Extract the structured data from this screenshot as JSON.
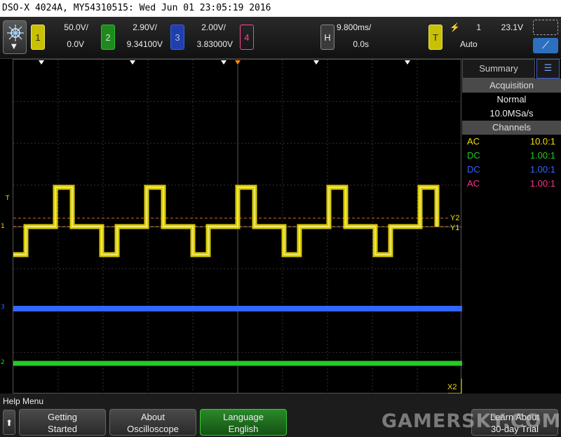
{
  "title_bar": "DSO-X 4024A, MY54310515: Wed Jun 01 23:05:19 2016",
  "channels": [
    {
      "label": "1",
      "scale": "50.0V/",
      "offset": "0.0V",
      "color": "#f0e000"
    },
    {
      "label": "2",
      "scale": "2.90V/",
      "offset": "9.34100V",
      "color": "#22cc22"
    },
    {
      "label": "3",
      "scale": "2.00V/",
      "offset": "3.83000V",
      "color": "#3366ff"
    },
    {
      "label": "4",
      "scale": "",
      "offset": "",
      "color": "#ff3388"
    }
  ],
  "horizontal": {
    "label": "H",
    "timebase": "9.800ms/",
    "delay": "0.0s"
  },
  "trigger": {
    "label": "T",
    "slope_icon": "rising-edge-icon",
    "source": "1",
    "level": "23.1V",
    "mode": "Auto"
  },
  "side_panel": {
    "tab_label": "Summary",
    "acquisition_header": "Acquisition",
    "acq_mode": "Normal",
    "sample_rate": "10.0MSa/s",
    "channels_header": "Channels",
    "channel_rows": [
      {
        "coupling": "AC",
        "probe": "10.0:1",
        "color": "#f0e000"
      },
      {
        "coupling": "DC",
        "probe": "1.00:1",
        "color": "#22cc22"
      },
      {
        "coupling": "DC",
        "probe": "1.00:1",
        "color": "#3366ff"
      },
      {
        "coupling": "AC",
        "probe": "1.00:1",
        "color": "#ff3388"
      }
    ]
  },
  "cursors": {
    "y2": "Y2",
    "y1": "Y1",
    "x2": "X2"
  },
  "graticule_markers": {
    "trigger": "T",
    "ch1": "1",
    "ch3": "3",
    "ch2": "2"
  },
  "help_menu": {
    "title": "Help Menu",
    "softkeys": [
      {
        "line1": "Getting",
        "line2": "Started"
      },
      {
        "line1": "About",
        "line2": "Oscilloscope"
      },
      {
        "line1": "Language",
        "line2": "English"
      },
      {
        "line1": "Learn About",
        "line2": "30-day Trial"
      }
    ]
  },
  "watermark": "GAMERSKY.COM"
}
